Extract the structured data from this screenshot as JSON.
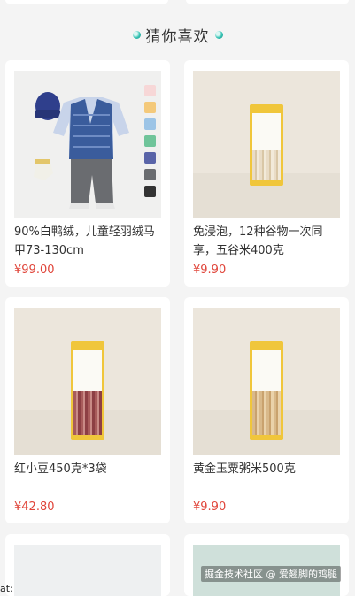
{
  "section": {
    "title": "猜你喜欢"
  },
  "products": [
    {
      "title": "90%白鸭绒，儿童轻羽绒马甲73-130cm",
      "price": "¥99.00"
    },
    {
      "title": "免浸泡，12种谷物一次同享，五谷米400克",
      "price": "¥9.90"
    },
    {
      "title": "红小豆450克*3袋",
      "price": "¥42.80"
    },
    {
      "title": "黄金玉粟粥米500克",
      "price": "¥9.90"
    }
  ],
  "watermark": "掘金技术社区 @ 爱翘脚的鸡腿",
  "footer": "at:",
  "colors": {
    "price": "#e0453a",
    "accent": "#37c4b5",
    "bag": "#f0c63b"
  }
}
